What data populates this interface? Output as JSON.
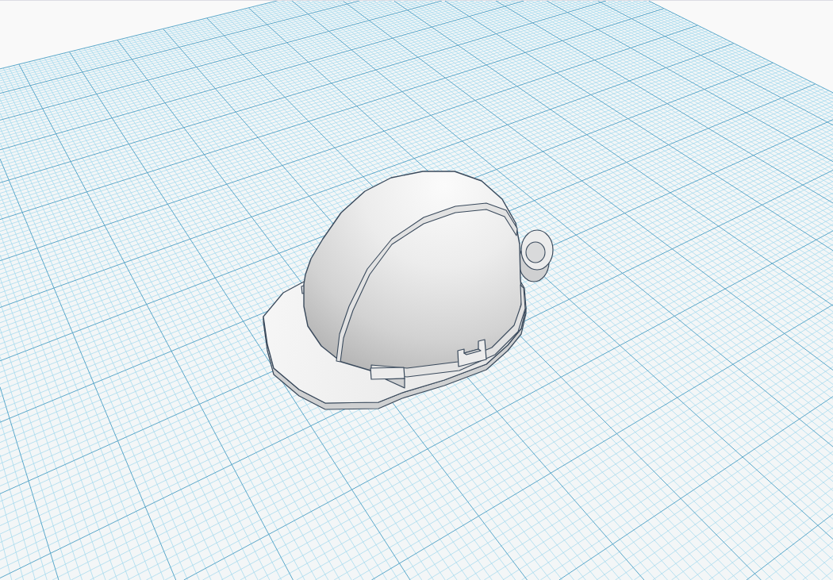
{
  "workplane": {
    "objects": [
      {
        "kind": "hard-hat"
      }
    ]
  }
}
